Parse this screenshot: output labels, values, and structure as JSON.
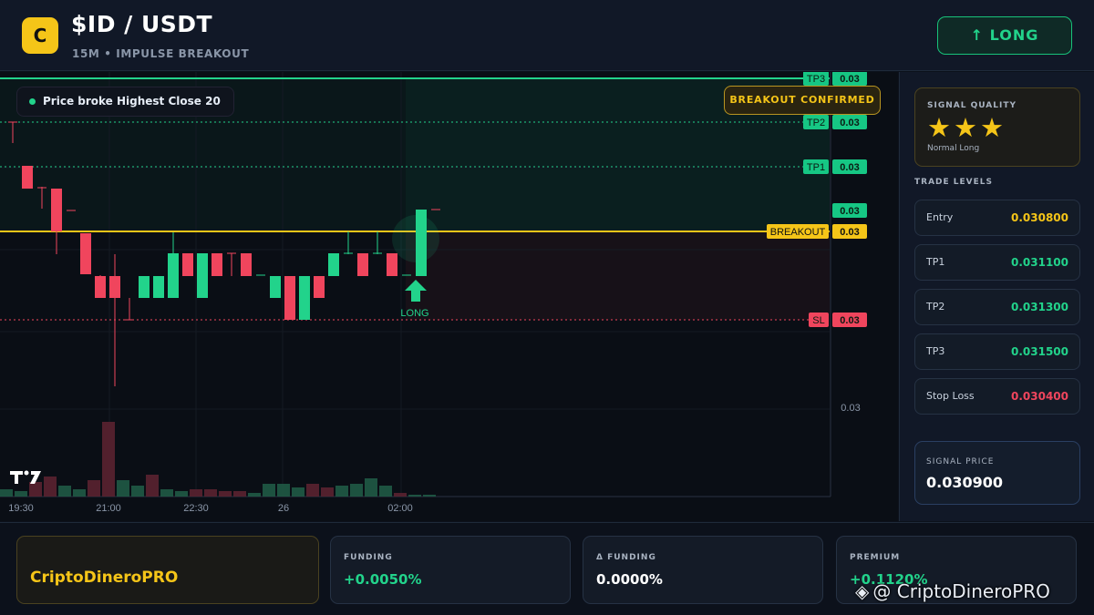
{
  "header": {
    "logo_letter": "C",
    "pair": "$ID / USDT",
    "subtitle": "15M • IMPULSE BREAKOUT",
    "direction_button": "↑ LONG"
  },
  "chart": {
    "note": "Price broke Highest Close 20",
    "status_badge": "BREAKOUT CONFIRMED",
    "signal_marker": "LONG",
    "watermark_logo": "TV",
    "price_axis_label": "0.03",
    "time_labels": [
      "19:30",
      "21:00",
      "22:30",
      "26",
      "02:00"
    ],
    "level_tags": [
      {
        "name": "TP3",
        "value": "0.03",
        "color": "#16c784"
      },
      {
        "name": "TP2",
        "value": "0.03",
        "color": "#16c784"
      },
      {
        "name": "TP1",
        "value": "0.03",
        "color": "#16c784"
      },
      {
        "name": "",
        "value": "0.03",
        "color": "#16c784"
      },
      {
        "name": "BREAKOUT",
        "value": "0.03",
        "color": "#f5c518"
      },
      {
        "name": "SL",
        "value": "0.03",
        "color": "#f0455d"
      }
    ],
    "colors": {
      "up": "#22d38b",
      "down": "#f0455d",
      "breakout": "#f5c518",
      "tp": "#16c784"
    }
  },
  "panel": {
    "quality_title": "SIGNAL QUALITY",
    "stars": "★★★",
    "quality_sub": "Normal Long",
    "levels_title": "TRADE LEVELS",
    "levels": [
      {
        "label": "Entry",
        "value": "0.030800",
        "color": "#f5c518"
      },
      {
        "label": "TP1",
        "value": "0.031100",
        "color": "#22d38b"
      },
      {
        "label": "TP2",
        "value": "0.031300",
        "color": "#22d38b"
      },
      {
        "label": "TP3",
        "value": "0.031500",
        "color": "#22d38b"
      },
      {
        "label": "Stop Loss",
        "value": "0.030400",
        "color": "#f0455d"
      }
    ],
    "signal_title": "SIGNAL PRICE",
    "signal_value": "0.030900"
  },
  "footer": {
    "brand": "CriptoDineroPRO",
    "metrics": [
      {
        "label": "FUNDING",
        "value": "+0.0050%",
        "color": "#22d38b"
      },
      {
        "label": "Δ FUNDING",
        "value": "0.0000%",
        "color": "#ffffff"
      },
      {
        "label": "PREMIUM",
        "value": "+0.1120%",
        "color": "#22d38b"
      }
    ],
    "watermark": "@ CriptoDineroPRO"
  }
}
